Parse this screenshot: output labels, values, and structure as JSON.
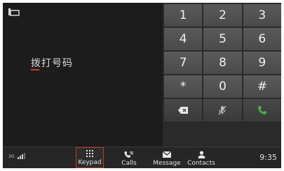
{
  "dialer": {
    "placeholder": "拨打号码"
  },
  "keypad": {
    "keys": [
      "1",
      "2",
      "3",
      "4",
      "5",
      "6",
      "7",
      "8",
      "9",
      "*",
      "0",
      "#"
    ],
    "star_glyph": "⋆",
    "hash_glyph": "♯"
  },
  "navbar": {
    "items": [
      {
        "label": "Keypad",
        "icon": "keypad-icon",
        "active": true
      },
      {
        "label": "Calls",
        "icon": "calls-icon",
        "active": false
      },
      {
        "label": "Message",
        "icon": "message-icon",
        "active": false
      },
      {
        "label": "Contacts",
        "icon": "contacts-icon",
        "active": false
      }
    ]
  },
  "status": {
    "network": "3G",
    "time": "9:35"
  },
  "colors": {
    "accent_red": "#c0392b",
    "call_green": "#3db34a",
    "key_bg": "#4f4f4f"
  }
}
